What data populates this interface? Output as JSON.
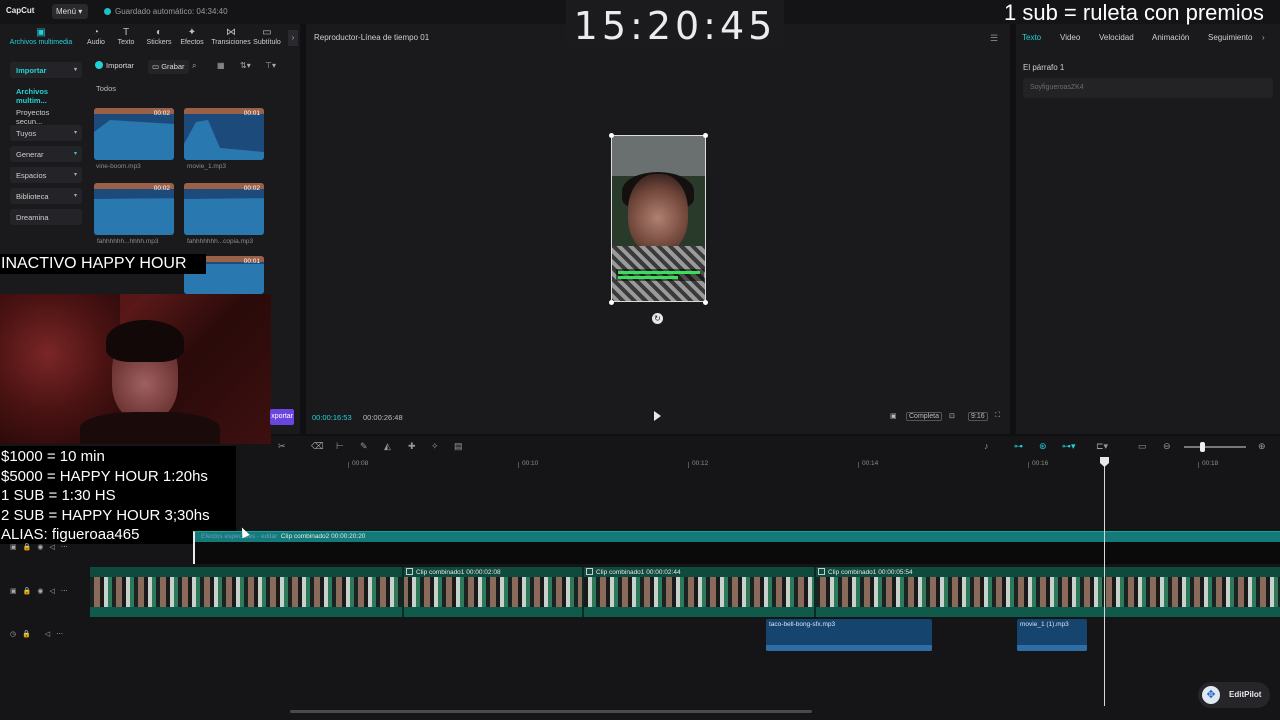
{
  "app": {
    "logo": "CapCut",
    "menu_label": "Menú",
    "autosave": "Guardado automático: 04:34:40"
  },
  "stream_overlay": {
    "clock": "15:20:45",
    "sub_banner": "1 sub = ruleta con premios",
    "inactivo": "INACTIVO HAPPY HOUR",
    "donations": [
      "$1000 = 10 min",
      "$5000 = HAPPY HOUR 1:20hs",
      "1 SUB = 1:30 HS",
      "2 SUB = HAPPY HOUR 3;30hs",
      "ALIAS: figueroaa465"
    ]
  },
  "tools": [
    {
      "label": "Archivos multimedia",
      "icon": "media-icon"
    },
    {
      "label": "Audio",
      "icon": "audio-icon"
    },
    {
      "label": "Texto",
      "icon": "text-icon"
    },
    {
      "label": "Stickers",
      "icon": "sticker-icon"
    },
    {
      "label": "Efectos",
      "icon": "effects-icon"
    },
    {
      "label": "Transiciones",
      "icon": "transition-icon"
    },
    {
      "label": "Subtítulo",
      "icon": "subtitle-icon"
    }
  ],
  "sidenav": [
    {
      "label": "Importar"
    },
    {
      "label": "Archivos multim..."
    },
    {
      "label": "Proyectos secun..."
    },
    {
      "label": "Tuyos"
    },
    {
      "label": "Generar"
    },
    {
      "label": "Espacios"
    },
    {
      "label": "Biblioteca"
    },
    {
      "label": "Dreamina"
    }
  ],
  "media_toolbar": {
    "import": "Importar",
    "grab": "Grabar",
    "section": "Todos"
  },
  "media_items": [
    {
      "name": "vine-boom.mp3",
      "duration": "00:02"
    },
    {
      "name": "movie_1.mp3",
      "duration": "00:01"
    },
    {
      "name": "fahhhhhh...hhhh.mp3",
      "duration": "00:02"
    },
    {
      "name": "fahhhhhhh...copia.mp3",
      "duration": "00:02"
    },
    {
      "name": "",
      "duration": "00:01"
    }
  ],
  "export_label": "Exportar",
  "player": {
    "title": "Reproductor-Línea de tiempo 01",
    "time_current": "00:00:16:53",
    "time_total": "00:00:26:48",
    "quality": "Completa",
    "ratio": "9:16"
  },
  "right_panel": {
    "tabs": [
      "Texto",
      "Video",
      "Velocidad",
      "Animación",
      "Seguimiento"
    ],
    "paragraph_label": "El párrafo 1",
    "text_value": "SoyfigueroasZK4"
  },
  "timeline": {
    "ruler": [
      "00:08",
      "00:10",
      "00:12",
      "00:14",
      "00:16",
      "00:18"
    ],
    "text_clip_fx": "Efectos especiales - editar",
    "text_clip": "Clip combinado2  00:00:20:20",
    "video_clips": [
      "Clip combinado1  00:00:02:08",
      "Clip combinado1  00:00:02:44",
      "Clip combinado1  00:00:05:54"
    ],
    "audio_clips": [
      "taco-bell-bong-sfx.mp3",
      "movie_1 (1).mp3"
    ]
  },
  "editpilot": "EditPilot",
  "colors": {
    "accent": "#22d1d6",
    "track_video": "#0f4a3e",
    "track_audio": "#15446e",
    "export": "#6a46e0"
  }
}
